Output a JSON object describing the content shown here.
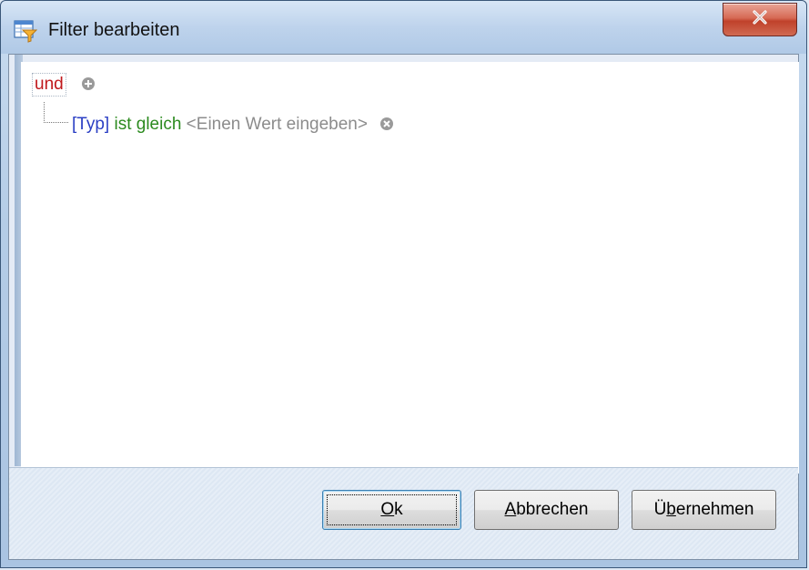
{
  "window": {
    "title": "Filter bearbeiten",
    "close_label": "✕"
  },
  "filter": {
    "group_operator": "und",
    "conditions": [
      {
        "field": "[Typ]",
        "operator": "ist gleich",
        "value_placeholder": "<Einen Wert eingeben>"
      }
    ]
  },
  "buttons": {
    "ok": {
      "mnemonic": "O",
      "rest": "k"
    },
    "cancel": {
      "mnemonic": "A",
      "rest": "bbrechen"
    },
    "apply": {
      "prefix": "Ü",
      "mnemonic": "b",
      "rest": "ernehmen"
    }
  },
  "colors": {
    "group_operator": "#c0181c",
    "field": "#2b3fc4",
    "operator": "#2b8a1e",
    "placeholder": "#8c8c8c",
    "close_button": "#c0412b"
  },
  "icons": {
    "app": "filter-table-icon",
    "add": "add-condition-icon",
    "remove": "remove-condition-icon",
    "close": "close-icon"
  }
}
